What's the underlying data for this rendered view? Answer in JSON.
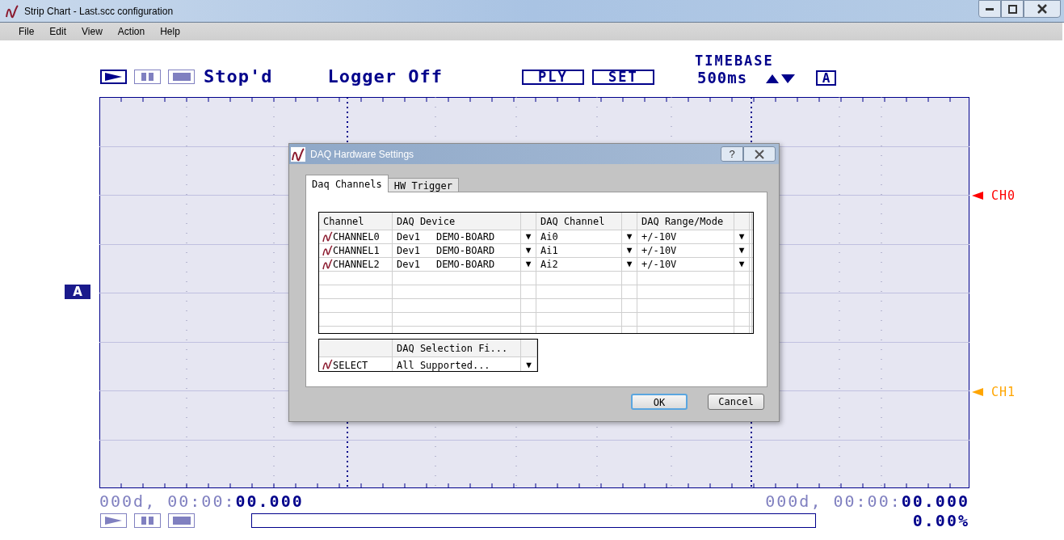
{
  "window": {
    "title": "Strip Chart - Last.scc configuration"
  },
  "menu": [
    "File",
    "Edit",
    "View",
    "Action",
    "Help"
  ],
  "toolbar": {
    "transport": [
      {
        "kind": "play",
        "active": true
      },
      {
        "kind": "pause",
        "active": false
      },
      {
        "kind": "stop",
        "active": false
      }
    ],
    "run_state": "Stop'd",
    "logger": "Logger Off",
    "buttons": [
      "PLY",
      "SET"
    ],
    "timebase_label": "TIMEBASE",
    "timebase_value": "500ms",
    "auto_button": "A"
  },
  "chart": {
    "left_marker": "A",
    "channel_markers": [
      {
        "label": "CH0",
        "color": "#ff0000"
      },
      {
        "label": "CH1",
        "color": "#ffa500"
      }
    ]
  },
  "dialog": {
    "title": "DAQ Hardware Settings",
    "help": "?",
    "tabs": [
      {
        "label": "Daq Channels",
        "selected": true
      },
      {
        "label": "HW Trigger",
        "selected": false
      }
    ],
    "table": {
      "columns": [
        "Channel",
        "DAQ Device",
        "DAQ Channel",
        "DAQ Range/Mode"
      ],
      "rows": [
        {
          "channel": "CHANNEL0",
          "device_id": "Dev1",
          "device_name": "DEMO-BOARD",
          "daq_channel": "Ai0",
          "range": "+/-10V"
        },
        {
          "channel": "CHANNEL1",
          "device_id": "Dev1",
          "device_name": "DEMO-BOARD",
          "daq_channel": "Ai1",
          "range": "+/-10V"
        },
        {
          "channel": "CHANNEL2",
          "device_id": "Dev1",
          "device_name": "DEMO-BOARD",
          "daq_channel": "Ai2",
          "range": "+/-10V"
        }
      ],
      "dropdown_glyph": "▼"
    },
    "selection": {
      "column": "DAQ Selection Fi...",
      "row_label": "SELECT",
      "value": "All Supported..."
    },
    "buttons": [
      "OK",
      "Cancel"
    ]
  },
  "footer": {
    "start_time": {
      "prefix": "000d, 00:00:",
      "seconds": "00.000"
    },
    "end_time": {
      "prefix": "000d, 00:00:",
      "seconds": "00.000"
    },
    "transport": [
      {
        "kind": "play",
        "active": false
      },
      {
        "kind": "pause",
        "active": false
      },
      {
        "kind": "stop",
        "active": false
      }
    ],
    "progress": {
      "level": 0
    },
    "percent": "0.00%"
  }
}
